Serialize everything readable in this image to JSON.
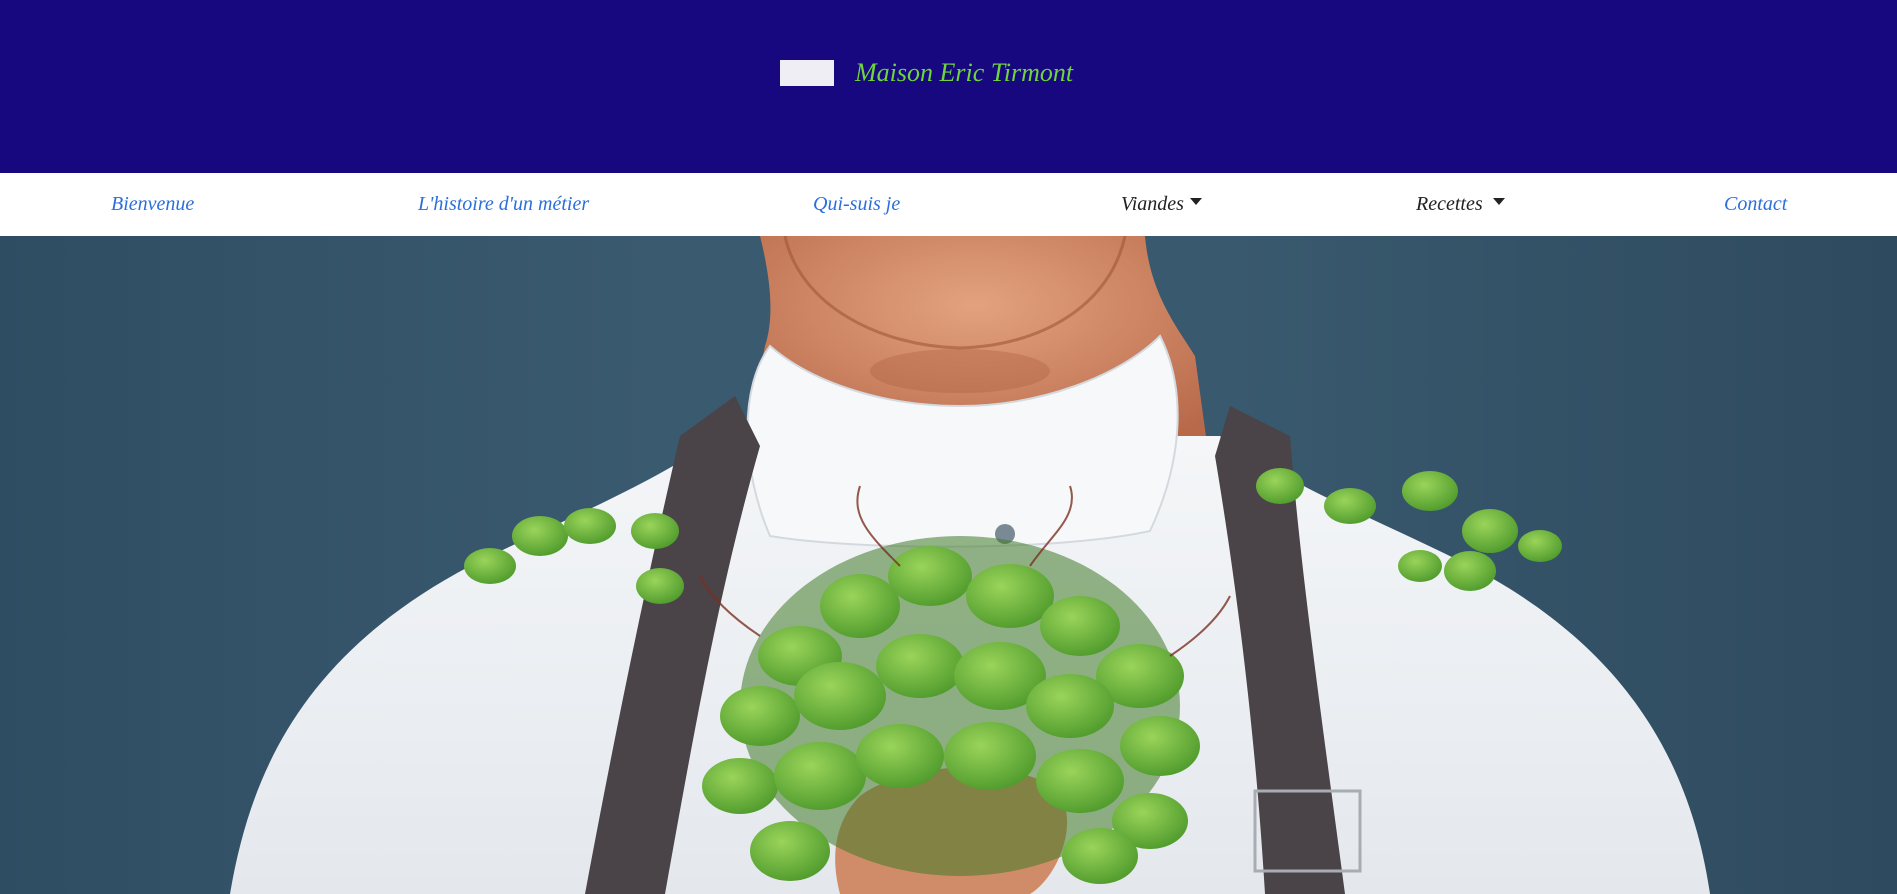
{
  "header": {
    "brand_name": "Maison Eric Tirmont",
    "logo_icon": "logo-placeholder-icon",
    "background_color": "#180880",
    "brand_color": "#6fd53a"
  },
  "nav": {
    "items": [
      {
        "label": "Bienvenue",
        "type": "link"
      },
      {
        "label": "L'histoire d'un métier",
        "type": "link"
      },
      {
        "label": "Qui-suis je",
        "type": "link"
      },
      {
        "label": "Viandes",
        "type": "dropdown",
        "icon": "caret-down-icon"
      },
      {
        "label": "Recettes",
        "type": "dropdown",
        "icon": "caret-down-icon"
      },
      {
        "label": "Contact",
        "type": "link"
      }
    ],
    "link_color": "#2a6fdb",
    "dropdown_color": "#222222"
  },
  "hero": {
    "subject": "chef-in-white-jacket-holding-microgreens",
    "background_color": "#39596e"
  }
}
